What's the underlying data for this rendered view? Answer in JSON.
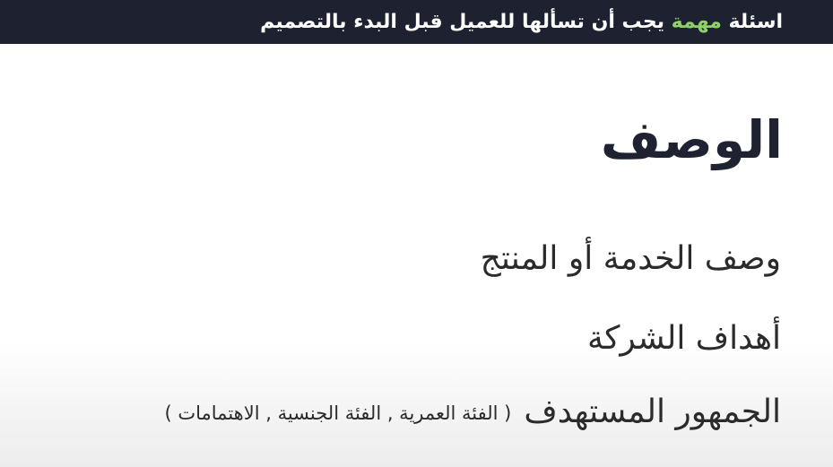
{
  "header": {
    "title_before": "اسئلة ",
    "title_accent": "مهمة",
    "title_after": " يجب أن تسألها للعميل قبل البدء بالتصميم",
    "accent_color": "#8fd06b",
    "background_color": "#1e2230"
  },
  "main": {
    "heading": "الوصف",
    "items": [
      {
        "label": "وصف  الخدمة أو المنتج"
      },
      {
        "label": "أهداف الشركة"
      },
      {
        "label": "الجمهور المستهدف",
        "note": "( الفئة العمرية , الفئة الجنسية , الاهتمامات )"
      }
    ]
  }
}
